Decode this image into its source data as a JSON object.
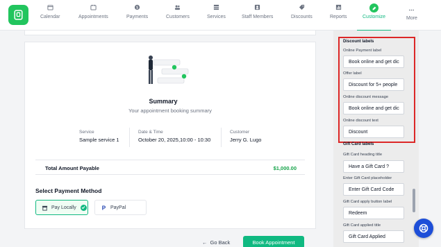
{
  "nav": {
    "items": [
      {
        "label": "Calendar",
        "icon": "calendar-icon"
      },
      {
        "label": "Appointments",
        "icon": "appointments-icon"
      },
      {
        "label": "Payments",
        "icon": "payments-icon"
      },
      {
        "label": "Customers",
        "icon": "customers-icon"
      },
      {
        "label": "Services",
        "icon": "services-icon"
      },
      {
        "label": "Staff Members",
        "icon": "staff-icon"
      },
      {
        "label": "Discounts",
        "icon": "discounts-icon"
      },
      {
        "label": "Reports",
        "icon": "reports-icon"
      },
      {
        "label": "Customize",
        "icon": "customize-icon",
        "active": true
      },
      {
        "label": "More",
        "icon": "more-icon"
      }
    ]
  },
  "summary": {
    "title": "Summary",
    "subtitle": "Your appointment booking summary",
    "service_label": "Service",
    "service_value": "Sample service 1",
    "datetime_label": "Date & Time",
    "datetime_value": "October 20, 2025,10:00 - 10:30",
    "customer_label": "Customer",
    "customer_value": "Jerry G. Lugo",
    "total_label": "Total Amount Payable",
    "total_value": "$1,000.00"
  },
  "payment": {
    "title": "Select Payment Method",
    "methods": [
      {
        "label": "Pay Locally",
        "selected": true
      },
      {
        "label": "PayPal",
        "selected": false
      }
    ]
  },
  "actions": {
    "back": "Go Back",
    "book": "Book Appointment"
  },
  "panel": {
    "discount_section": "Discount labels",
    "gift_section": "Gift Card labels",
    "fields": [
      {
        "label": "Online Payment label",
        "value": "Book online and get dic"
      },
      {
        "label": "Offer label",
        "value": "Discount for 5+ people"
      },
      {
        "label": "Online discount message",
        "value": "Book online and get dic"
      },
      {
        "label": "Online discount text",
        "value": "Discount"
      },
      {
        "label": "Gift Card heading title",
        "value": "Have a Gift Card ?"
      },
      {
        "label": "Enter Gift Card placeholder",
        "value": "Enter Gift Card Code"
      },
      {
        "label": "Gift Card apply button label",
        "value": "Redeem"
      },
      {
        "label": "Gift Card applied title",
        "value": "Gift Card Applied"
      }
    ]
  },
  "colors": {
    "accent": "#10b981",
    "highlight": "#dc2626",
    "fab": "#1d4ed8"
  }
}
